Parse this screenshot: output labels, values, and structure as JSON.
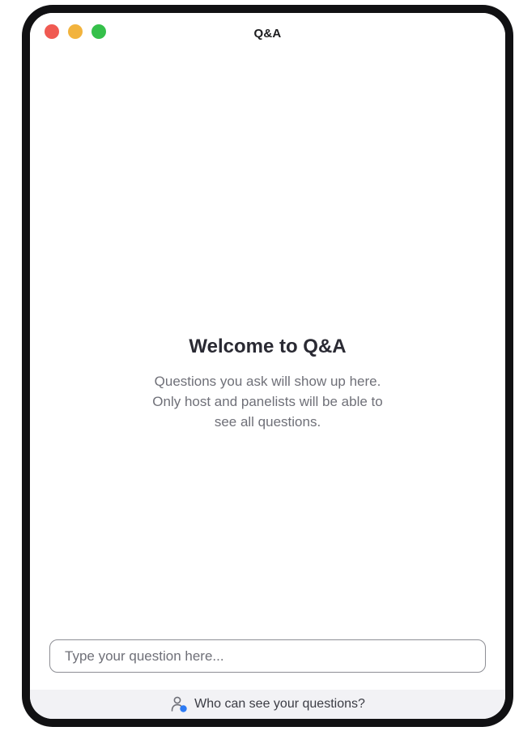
{
  "window": {
    "title": "Q&A",
    "controls": {
      "close": "close-button",
      "minimize": "minimize-button",
      "zoom": "zoom-button"
    }
  },
  "welcome": {
    "heading": "Welcome to Q&A",
    "message": "Questions you ask will show up here. Only host and panelists will be able to see all questions."
  },
  "question_input": {
    "placeholder": "Type your question here...",
    "value": ""
  },
  "footer": {
    "icon": "user-visibility-icon",
    "link_text": "Who can see your questions?"
  },
  "colors": {
    "close": "#f05a52",
    "minimize": "#f2b33d",
    "zoom": "#35c04a",
    "accent": "#2d7bf4",
    "frame": "#111113"
  }
}
